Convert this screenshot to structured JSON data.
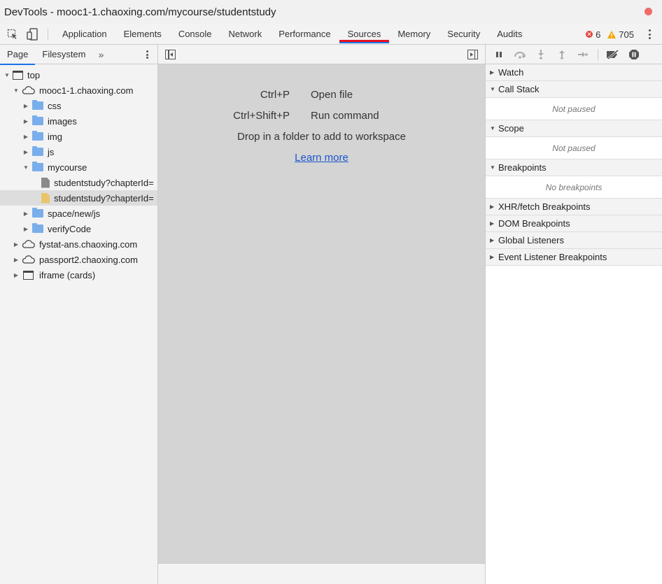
{
  "window": {
    "title": "DevTools - mooc1-1.chaoxing.com/mycourse/studentstudy"
  },
  "toolbar": {
    "tabs": [
      {
        "label": "Application"
      },
      {
        "label": "Elements"
      },
      {
        "label": "Console"
      },
      {
        "label": "Network"
      },
      {
        "label": "Performance"
      },
      {
        "label": "Sources"
      },
      {
        "label": "Memory"
      },
      {
        "label": "Security"
      },
      {
        "label": "Audits"
      }
    ],
    "active_tab": "Sources",
    "error_count": "6",
    "warning_count": "705"
  },
  "navigator": {
    "tabs": [
      {
        "label": "Page"
      },
      {
        "label": "Filesystem"
      }
    ],
    "more_label": "»",
    "tree": [
      {
        "label": "top"
      },
      {
        "label": "mooc1-1.chaoxing.com"
      },
      {
        "label": "css"
      },
      {
        "label": "images"
      },
      {
        "label": "img"
      },
      {
        "label": "js"
      },
      {
        "label": "mycourse"
      },
      {
        "label": "studentstudy?chapterId="
      },
      {
        "label": "studentstudy?chapterId="
      },
      {
        "label": "space/new/js"
      },
      {
        "label": "verifyCode"
      },
      {
        "label": "fystat-ans.chaoxing.com"
      },
      {
        "label": "passport2.chaoxing.com"
      },
      {
        "label": "iframe (cards)"
      }
    ]
  },
  "editor": {
    "shortcuts": [
      {
        "keys": "Ctrl+P",
        "action": "Open file"
      },
      {
        "keys": "Ctrl+Shift+P",
        "action": "Run command"
      }
    ],
    "drop_text": "Drop in a folder to add to workspace",
    "learn_more": "Learn more"
  },
  "debugger": {
    "sections": {
      "watch": "Watch",
      "call_stack": "Call Stack",
      "call_stack_empty": "Not paused",
      "scope": "Scope",
      "scope_empty": "Not paused",
      "breakpoints": "Breakpoints",
      "breakpoints_empty": "No breakpoints",
      "xhr": "XHR/fetch Breakpoints",
      "dom": "DOM Breakpoints",
      "global": "Global Listeners",
      "event": "Event Listener Breakpoints"
    }
  },
  "colors": {
    "accent_blue": "#1a73e8",
    "active_tab_underline": "#e81123",
    "folder": "#7aaeea",
    "editor_bg": "#d4d4d4",
    "link": "#1a55cc"
  }
}
